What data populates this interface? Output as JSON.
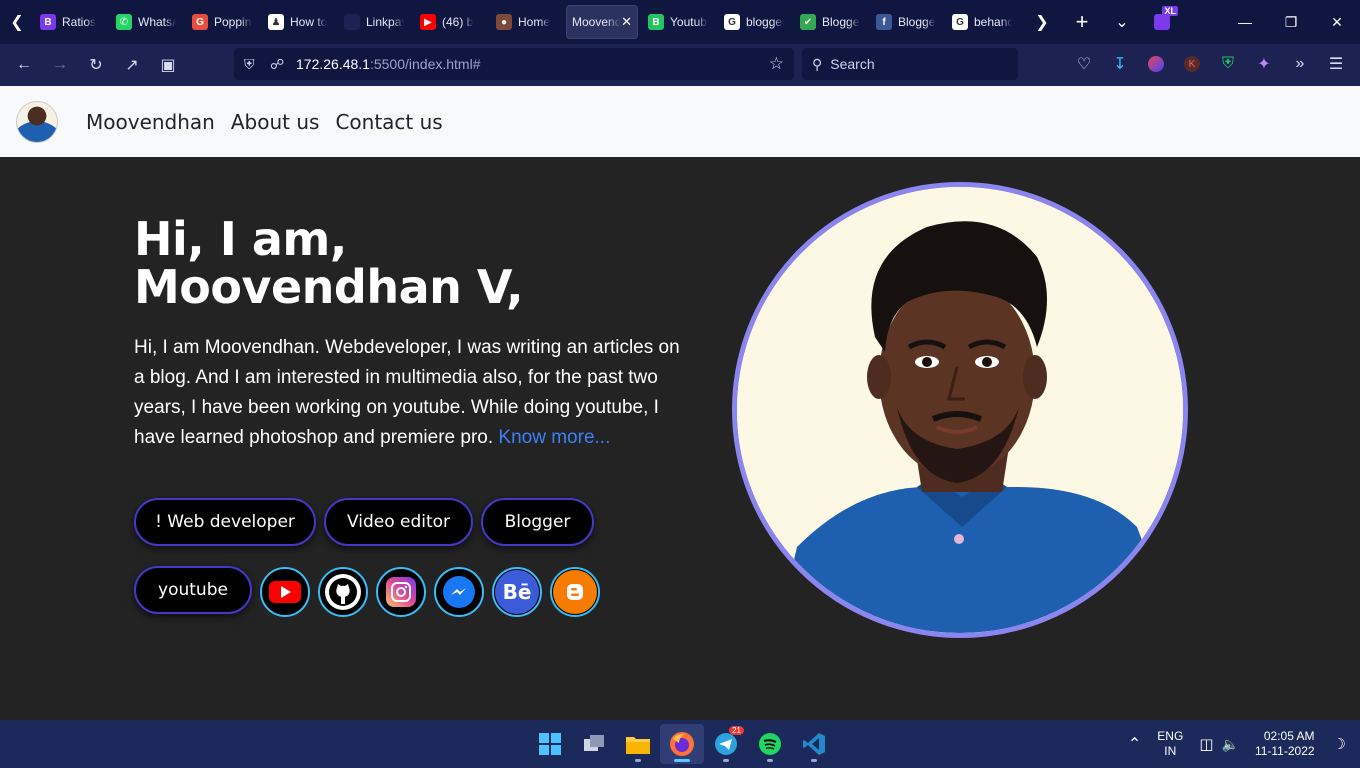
{
  "browser": {
    "tabs": [
      {
        "label": "Ratios",
        "favicon_color": "#7c3aed",
        "favicon_glyph": "B"
      },
      {
        "label": "WhatsApp",
        "favicon_color": "#25d366",
        "favicon_glyph": "✆"
      },
      {
        "label": "Poppins",
        "favicon_color": "#e84d3d",
        "favicon_glyph": "G"
      },
      {
        "label": "How to",
        "favicon_color": "#ffffff",
        "favicon_glyph": "♟"
      },
      {
        "label": "Linkpays -",
        "favicon_color": "#1c2353",
        "favicon_glyph": ""
      },
      {
        "label": "(46) b",
        "favicon_color": "#ff0000",
        "favicon_glyph": "▶"
      },
      {
        "label": "Home",
        "favicon_color": "#7b4a3a",
        "favicon_glyph": "●"
      },
      {
        "label": "Moovendhan",
        "favicon_color": "",
        "favicon_glyph": "",
        "active": true
      },
      {
        "label": "Youtube",
        "favicon_color": "#22c55e",
        "favicon_glyph": "B"
      },
      {
        "label": "blogger",
        "favicon_color": "#ffffff",
        "favicon_glyph": "G"
      },
      {
        "label": "Blogger",
        "favicon_color": "#34a853",
        "favicon_glyph": "✔"
      },
      {
        "label": "Blogger",
        "favicon_color": "#3b5998",
        "favicon_glyph": "f"
      },
      {
        "label": "behance",
        "favicon_color": "#ffffff",
        "favicon_glyph": "G"
      }
    ],
    "url_host": "172.26.48.1",
    "url_path": ":5500/index.html#",
    "search_placeholder": "Search",
    "extension_badge": "XL"
  },
  "site_nav": {
    "brand": "Moovendhan",
    "links": [
      "About us",
      "Contact us"
    ]
  },
  "hero": {
    "heading_line1": "Hi, I am,",
    "heading_line2": "Moovendhan V,",
    "intro": "Hi, I am Moovendhan. Webdeveloper, I was writing an articles on a blog. And I am interested in multimedia also, for the past two years, I have been working on youtube. While doing youtube, I have learned photoshop and premiere pro.",
    "know_more": "Know more...",
    "skills": [
      "! Web developer",
      "Video editor",
      "Blogger",
      "youtube"
    ],
    "socials": [
      "youtube-icon",
      "github-icon",
      "instagram-icon",
      "messenger-icon",
      "behance-icon",
      "blogger-icon"
    ],
    "accent_color": "#4338ca",
    "portrait_border_color": "#8b85f0"
  },
  "taskbar": {
    "telegram_badge": "21",
    "lang_line1": "ENG",
    "lang_line2": "IN",
    "time": "02:05 AM",
    "date": "11-11-2022"
  }
}
